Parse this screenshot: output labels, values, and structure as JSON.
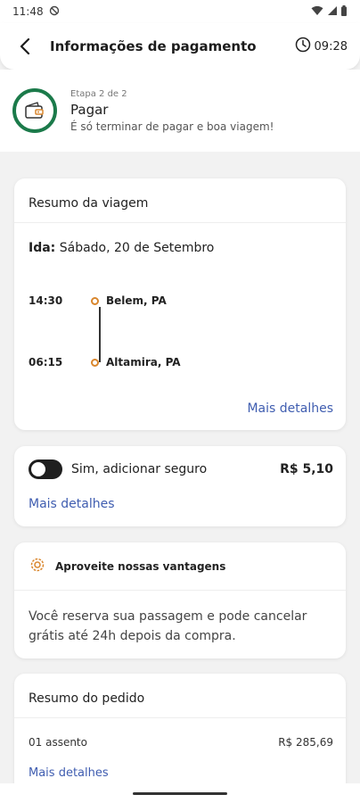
{
  "status_bar": {
    "time": "11:48"
  },
  "header": {
    "title": "Informações de pagamento",
    "timer": "09:28"
  },
  "step": {
    "kicker": "Etapa 2 de 2",
    "name": "Pagar",
    "description": "É só terminar de pagar e boa viagem!"
  },
  "trip_summary": {
    "title": "Resumo da viagem",
    "ida_label": "Ida:",
    "ida_date": " Sábado, 20 de Setembro",
    "departure": {
      "time": "14:30",
      "place": "Belem, PA"
    },
    "arrival": {
      "time": "06:15",
      "place": "Altamira, PA"
    },
    "more_link": "Mais detalhes"
  },
  "insurance": {
    "label": "Sim, adicionar seguro",
    "price": "R$ 5,10",
    "more_link": "Mais detalhes",
    "enabled": false
  },
  "perks": {
    "title": "Aproveite nossas vantagens",
    "body": "Você reserva sua passagem e pode cancelar grátis até 24h depois da compra."
  },
  "order_summary": {
    "title": "Resumo do pedido",
    "item_label": "01 assento",
    "item_price": "R$ 285,69",
    "more_link": "Mais detalhes"
  },
  "colors": {
    "accent_green": "#1b7a4a",
    "link_blue": "#3f5db0",
    "route_orange": "#d9862d"
  }
}
